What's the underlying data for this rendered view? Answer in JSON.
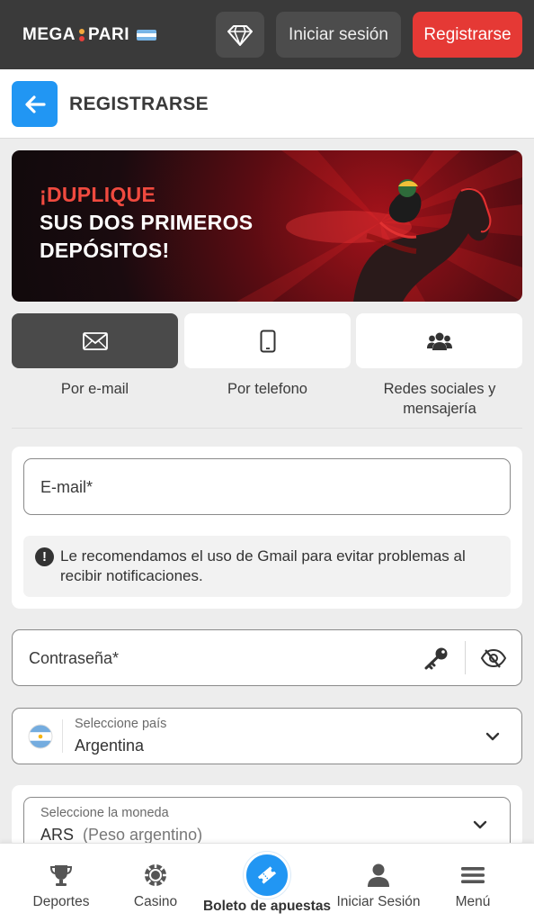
{
  "topbar": {
    "logo_left": "MEGA",
    "logo_right": "PARI",
    "gem_icon": "diamond-icon",
    "login_label": "Iniciar sesión",
    "register_label": "Registrarse"
  },
  "header": {
    "back_icon": "arrow-left-icon",
    "title": "REGISTRARSE"
  },
  "banner": {
    "line1": "¡DUPLIQUE",
    "line2": "SUS DOS PRIMEROS",
    "line3": "DEPÓSITOS!"
  },
  "tabs": [
    {
      "label": "Por e-mail",
      "icon": "envelope-icon",
      "active": true
    },
    {
      "label": "Por telefono",
      "icon": "phone-icon",
      "active": false
    },
    {
      "label": "Redes sociales y mensajería",
      "icon": "users-icon",
      "active": false
    }
  ],
  "form": {
    "email_placeholder": "E-mail*",
    "notice": "Le recomendamos el uso de Gmail para evitar problemas al recibir notificaciones.",
    "password_placeholder": "Contraseña*",
    "country_label": "Seleccione país",
    "country_value": "Argentina",
    "currency_label": "Seleccione la moneda",
    "currency_code": "ARS",
    "currency_name": "(Peso argentino)"
  },
  "bottom_nav": [
    {
      "label": "Deportes",
      "icon": "trophy-icon"
    },
    {
      "label": "Casino",
      "icon": "casino-chip-icon"
    },
    {
      "label": "Boleto de apuestas",
      "icon": "ticket-icon"
    },
    {
      "label": "Iniciar Sesión",
      "icon": "user-icon"
    },
    {
      "label": "Menú",
      "icon": "menu-icon"
    }
  ],
  "colors": {
    "accent_red": "#e53935",
    "accent_blue": "#2196f3",
    "topbar_bg": "#3a3a3a"
  }
}
